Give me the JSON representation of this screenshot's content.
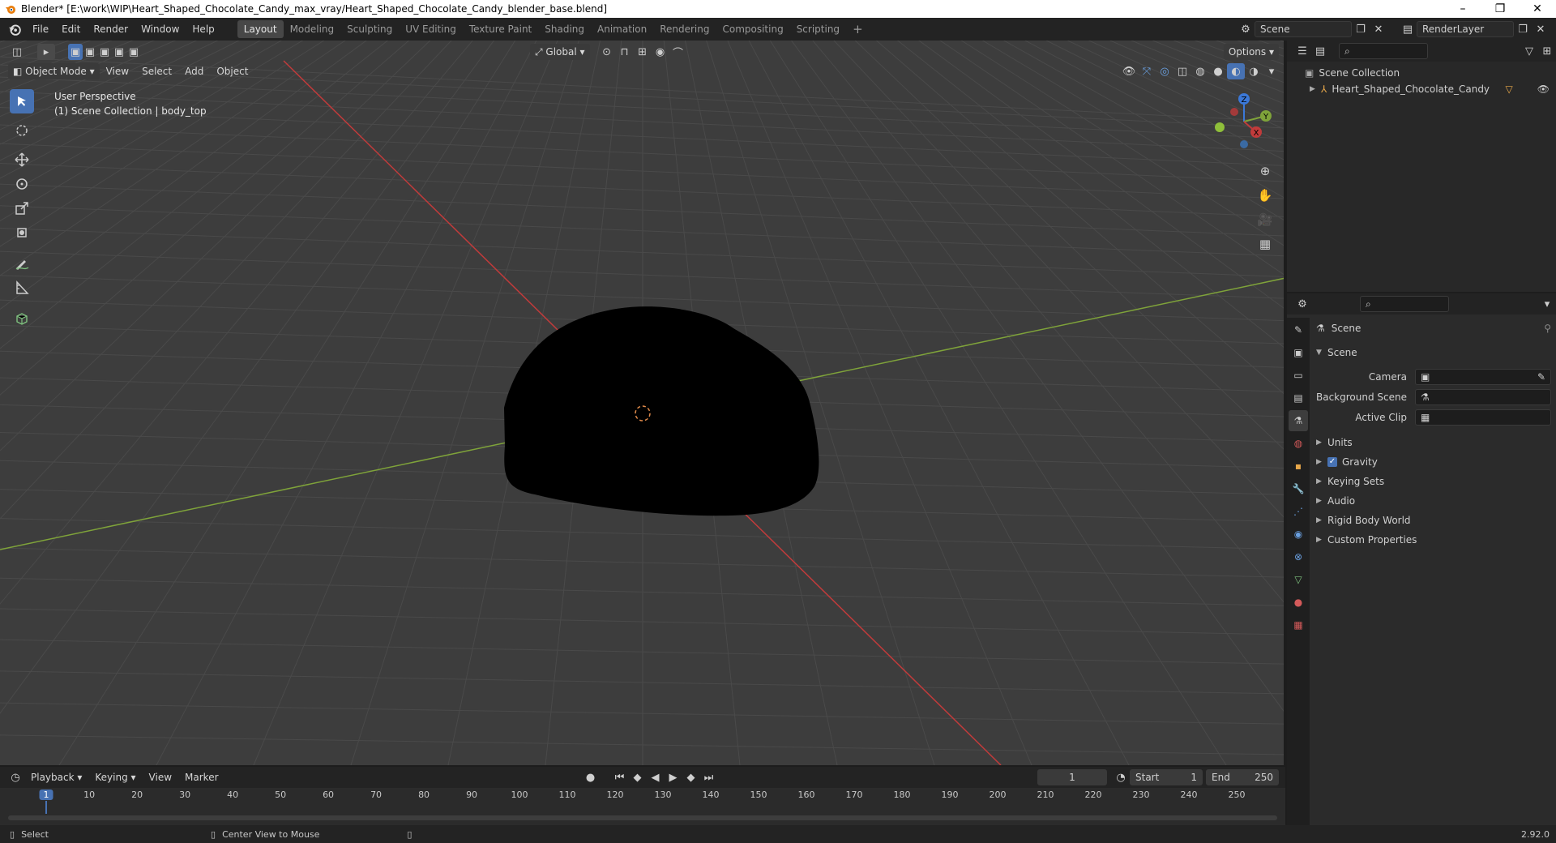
{
  "window": {
    "title": "Blender* [E:\\work\\WIP\\Heart_Shaped_Chocolate_Candy_max_vray/Heart_Shaped_Chocolate_Candy_blender_base.blend]",
    "minimize": "–",
    "maximize": "❐",
    "close": "✕"
  },
  "menu": [
    "File",
    "Edit",
    "Render",
    "Window",
    "Help"
  ],
  "workspaces": [
    "Layout",
    "Modeling",
    "Sculpting",
    "UV Editing",
    "Texture Paint",
    "Shading",
    "Animation",
    "Rendering",
    "Compositing",
    "Scripting"
  ],
  "scene_field": "Scene",
  "render_layer_field": "RenderLayer",
  "viewport": {
    "transform_orientation": "Global",
    "options_label": "Options",
    "mode": "Object Mode",
    "header_menus": [
      "View",
      "Select",
      "Add",
      "Object"
    ],
    "overlay_line1": "User Perspective",
    "overlay_line2": "(1) Scene Collection | body_top",
    "gizmo": {
      "x": "X",
      "y": "Y",
      "z": "Z"
    }
  },
  "outliner": {
    "root": "Scene Collection",
    "items": [
      {
        "label": "Heart_Shaped_Chocolate_Candy"
      }
    ]
  },
  "properties": {
    "header": "Scene",
    "section": "Scene",
    "fields": [
      {
        "label": "Camera",
        "value": ""
      },
      {
        "label": "Background Scene",
        "value": ""
      },
      {
        "label": "Active Clip",
        "value": ""
      }
    ],
    "panels": [
      "Units",
      "Gravity",
      "Keying Sets",
      "Audio",
      "Rigid Body World",
      "Custom Properties"
    ],
    "gravity_checked": true
  },
  "timeline": {
    "menus": [
      "Playback",
      "Keying",
      "View",
      "Marker"
    ],
    "current_frame": "1",
    "start_label": "Start",
    "start_value": "1",
    "end_label": "End",
    "end_value": "250",
    "ticks": [
      "1",
      "10",
      "20",
      "30",
      "40",
      "50",
      "60",
      "70",
      "80",
      "90",
      "100",
      "110",
      "120",
      "130",
      "140",
      "150",
      "160",
      "170",
      "180",
      "190",
      "200",
      "210",
      "220",
      "230",
      "240",
      "250"
    ]
  },
  "status": {
    "select": "Select",
    "center_view": "Center View to Mouse",
    "version": "2.92.0"
  },
  "colors": {
    "accent": "#4772b3",
    "x_axis": "#c13b3b",
    "y_axis": "#7fa33a",
    "frame_indicator": "#4772b3"
  }
}
